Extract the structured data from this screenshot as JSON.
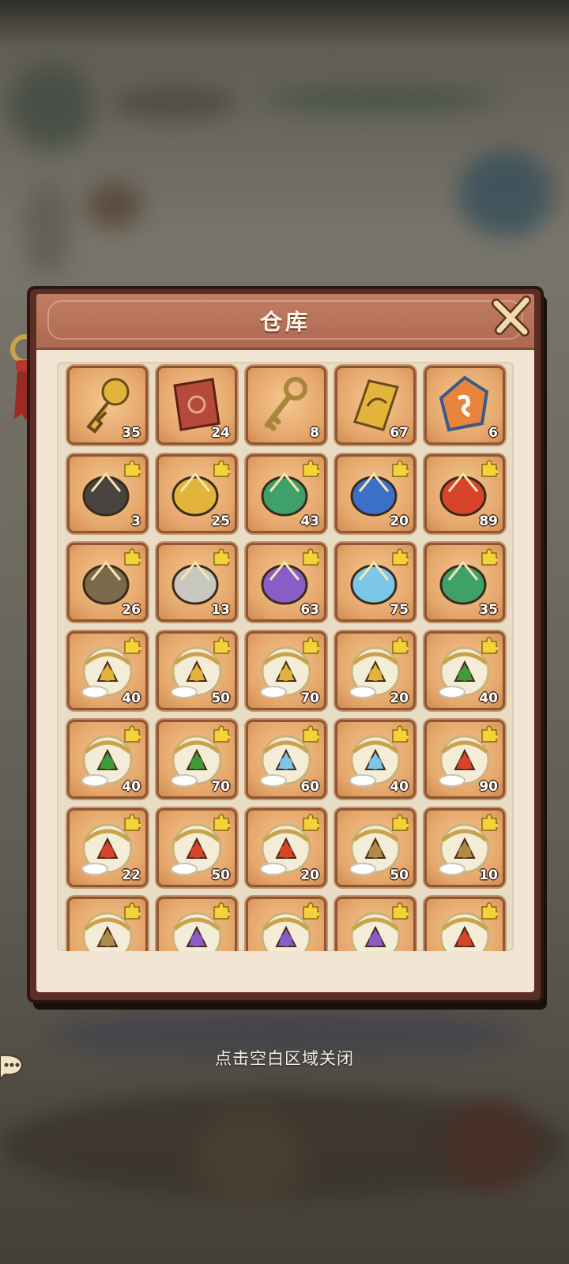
{
  "panel": {
    "title": "仓库",
    "close_icon": "close-x-icon"
  },
  "hint": "点击空白区域关闭",
  "colors": {
    "panel_border": "#5b2d24",
    "header": "#b5705a",
    "slot_bg": "#e4a56a",
    "count_text": "#ffffff"
  },
  "items": [
    {
      "icon": "golden-spiral-key-icon",
      "count": "35",
      "fragment": false
    },
    {
      "icon": "red-scroll-icon",
      "count": "24",
      "fragment": false
    },
    {
      "icon": "bronze-key-icon",
      "count": "8",
      "fragment": false
    },
    {
      "icon": "golden-talisman-icon",
      "count": "67",
      "fragment": false
    },
    {
      "icon": "rainbow-gem-icon",
      "count": "6",
      "fragment": false
    },
    {
      "icon": "pagoda-fragment-icon",
      "count": "3",
      "fragment": true
    },
    {
      "icon": "golden-axe-fragment-icon",
      "count": "25",
      "fragment": true
    },
    {
      "icon": "jade-gauntlet-fragment-icon",
      "count": "43",
      "fragment": true
    },
    {
      "icon": "blue-orb-ring-fragment-icon",
      "count": "20",
      "fragment": true
    },
    {
      "icon": "fire-wheel-fragment-icon",
      "count": "89",
      "fragment": true
    },
    {
      "icon": "bronze-cauldron-fragment-icon",
      "count": "26",
      "fragment": true
    },
    {
      "icon": "sword-fragment-icon",
      "count": "13",
      "fragment": true
    },
    {
      "icon": "purple-gem-ring-fragment-icon",
      "count": "63",
      "fragment": true
    },
    {
      "icon": "crystal-tree-fragment-icon",
      "count": "75",
      "fragment": true
    },
    {
      "icon": "jade-scale-fragment-icon",
      "count": "35",
      "fragment": true
    },
    {
      "icon": "dragon-scroll-gold-fragment-icon",
      "count": "40",
      "fragment": true
    },
    {
      "icon": "dragon-scroll-gold-fragment-icon",
      "count": "50",
      "fragment": true
    },
    {
      "icon": "dragon-scroll-gold-fragment-icon",
      "count": "70",
      "fragment": true
    },
    {
      "icon": "dragon-scroll-gold-fragment-icon",
      "count": "20",
      "fragment": true
    },
    {
      "icon": "dragon-scroll-green-fragment-icon",
      "count": "40",
      "fragment": true
    },
    {
      "icon": "dragon-scroll-green-fragment-icon",
      "count": "40",
      "fragment": true
    },
    {
      "icon": "dragon-scroll-green-fragment-icon",
      "count": "70",
      "fragment": true
    },
    {
      "icon": "dragon-scroll-ice-fragment-icon",
      "count": "60",
      "fragment": true
    },
    {
      "icon": "dragon-scroll-ice-fragment-icon",
      "count": "40",
      "fragment": true
    },
    {
      "icon": "dragon-scroll-fire-fragment-icon",
      "count": "90",
      "fragment": true
    },
    {
      "icon": "dragon-scroll-fire-fragment-icon",
      "count": "22",
      "fragment": true
    },
    {
      "icon": "dragon-scroll-fire-fragment-icon",
      "count": "50",
      "fragment": true
    },
    {
      "icon": "dragon-scroll-fire-fragment-icon",
      "count": "20",
      "fragment": true
    },
    {
      "icon": "dragon-scroll-earth-fragment-icon",
      "count": "50",
      "fragment": true
    },
    {
      "icon": "dragon-scroll-earth-fragment-icon",
      "count": "10",
      "fragment": true
    },
    {
      "icon": "dragon-scroll-earth-fragment-icon",
      "count": "",
      "fragment": true
    },
    {
      "icon": "dragon-scroll-purple-fragment-icon",
      "count": "",
      "fragment": true
    },
    {
      "icon": "dragon-scroll-purple-fragment-icon",
      "count": "",
      "fragment": true
    },
    {
      "icon": "dragon-scroll-purple-fragment-icon",
      "count": "",
      "fragment": true
    },
    {
      "icon": "dragon-scroll-fire-fragment-icon",
      "count": "",
      "fragment": true
    }
  ]
}
